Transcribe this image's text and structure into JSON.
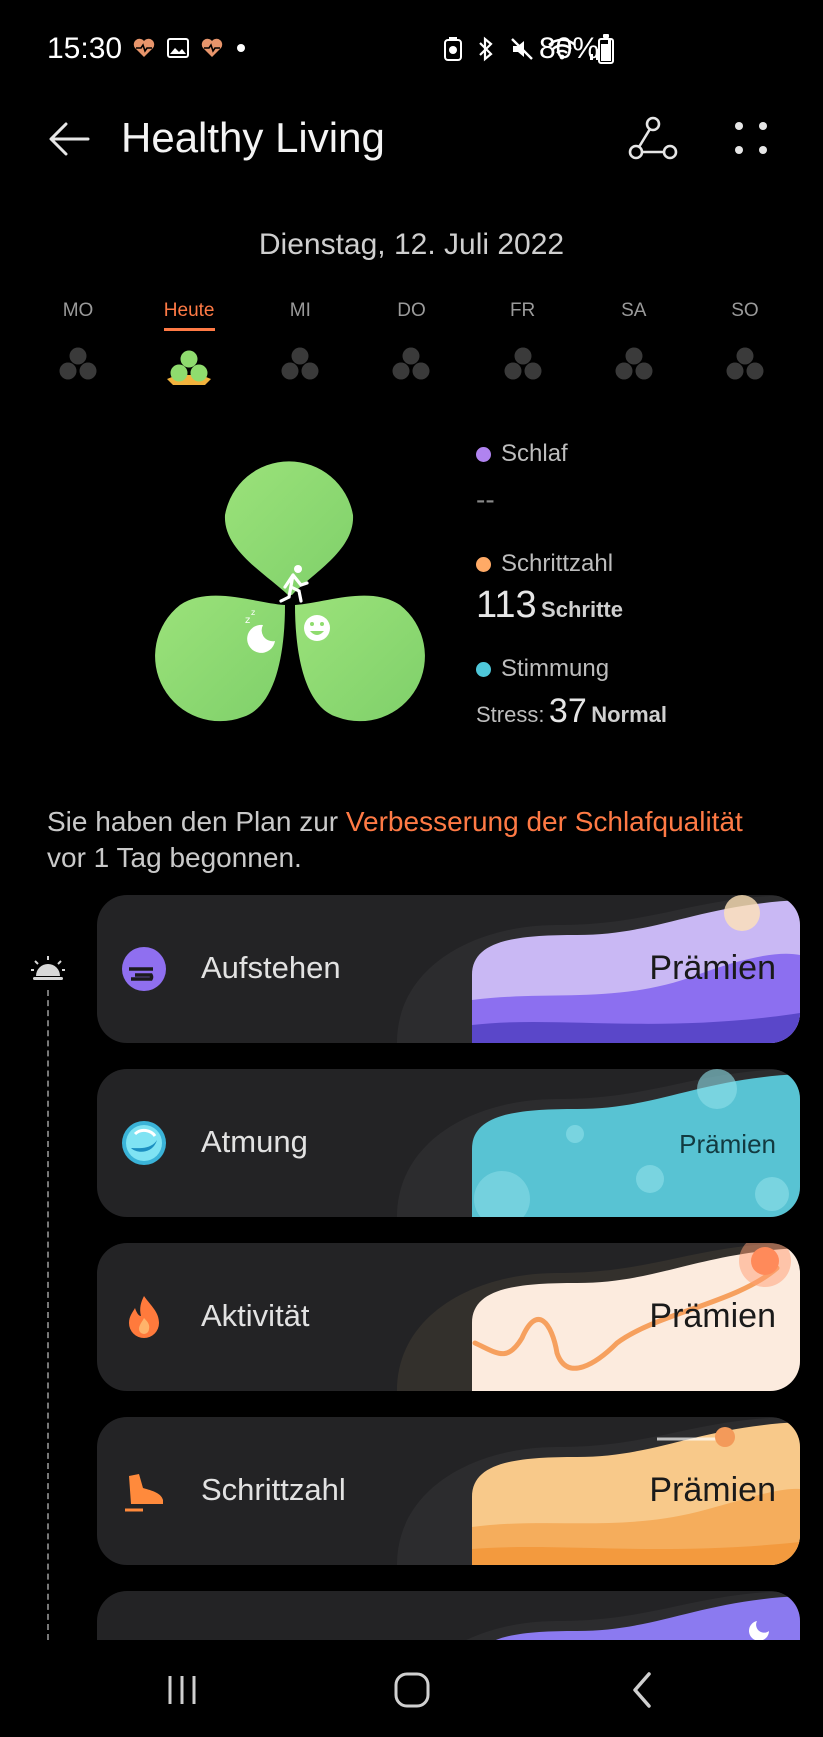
{
  "status_bar": {
    "time": "15:30",
    "battery": "80%",
    "left_icons": [
      "heart-rate-icon",
      "gallery-icon",
      "heart-rate-icon",
      "notification-dot-icon"
    ],
    "right_icons": [
      "battery-saver-icon",
      "bluetooth-icon",
      "mute-icon",
      "wifi-icon",
      "signal-icon",
      "battery-icon"
    ]
  },
  "header": {
    "title": "Healthy Living"
  },
  "date": "Dienstag, 12. Juli 2022",
  "week": [
    {
      "label": "MO",
      "active": false
    },
    {
      "label": "Heute",
      "active": true
    },
    {
      "label": "MI",
      "active": false
    },
    {
      "label": "DO",
      "active": false
    },
    {
      "label": "FR",
      "active": false
    },
    {
      "label": "SA",
      "active": false
    },
    {
      "label": "SO",
      "active": false
    }
  ],
  "summary": {
    "sleep": {
      "label": "Schlaf",
      "value": "--",
      "color": "#b083f0"
    },
    "steps": {
      "label": "Schrittzahl",
      "value": "113",
      "unit": "Schritte",
      "color": "#ffaa66"
    },
    "mood": {
      "label": "Stimmung",
      "stress_label": "Stress:",
      "stress_value": "37",
      "stress_status": "Normal",
      "color": "#4ec7d9"
    }
  },
  "plan": {
    "prefix": "Sie haben den Plan zur ",
    "highlight": "Verbesserung der Schlafqualität",
    "suffix": " vor 1 Tag begonnen."
  },
  "cards": [
    {
      "title": "Aufstehen",
      "reward": "Prämien",
      "icon": "sunrise-icon"
    },
    {
      "title": "Atmung",
      "reward": "Prämien",
      "icon": "breathing-icon"
    },
    {
      "title": "Aktivität",
      "reward": "Prämien",
      "icon": "flame-icon"
    },
    {
      "title": "Schrittzahl",
      "reward": "Prämien",
      "icon": "shoe-icon"
    }
  ],
  "colors": {
    "accent": "#ff7a45",
    "clover_green": "#8fdc6e",
    "card_bg": "#232325"
  }
}
